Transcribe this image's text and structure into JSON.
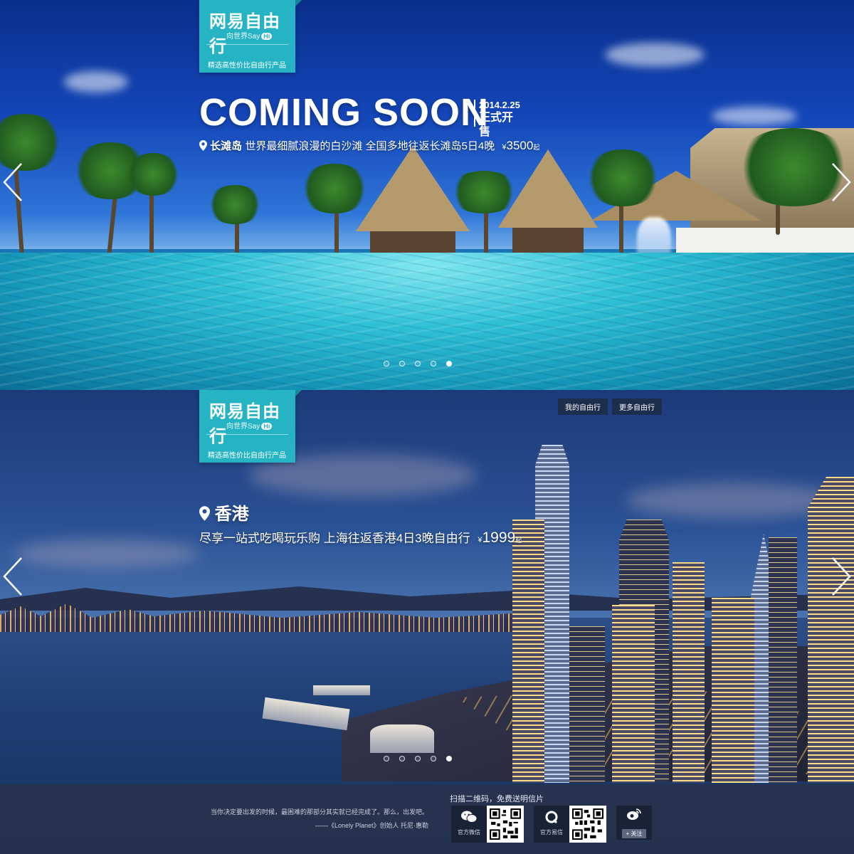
{
  "brand": {
    "logo_text": "网易自由行",
    "tagline": "向世界Say",
    "tagline_badge": "Hi",
    "slogan": "精选高性价比自由行产品"
  },
  "banner1": {
    "headline": "COMING SOON",
    "sale_date": "2014.2.25",
    "sale_label": "正式开售",
    "location": "长滩岛",
    "description": "世界最细腻浪漫的白沙滩  全国多地往返长滩岛5日4晚",
    "currency": "¥",
    "price": "3500",
    "price_suffix": "起",
    "carousel_dots": 5,
    "active_dot": 4
  },
  "banner2": {
    "nav": {
      "my_trip": "我的自由行",
      "more_trips": "更多自由行"
    },
    "location": "香港",
    "description": "尽享一站式吃喝玩乐购 上海往返香港4日3晚自由行",
    "currency": "¥",
    "price": "1999",
    "price_suffix": "起",
    "carousel_dots": 5,
    "active_dot": 4
  },
  "footer": {
    "quote_line1": "当你决定要出发的时候，最困难的那部分其实就已经完成了。那么，出发吧。",
    "quote_line2": "——《Lonely Planet》创始人 托尼·惠勒",
    "scan_title": "扫描二维码，免费送明信片",
    "wechat_label": "官方微信",
    "yixin_label": "官方易信",
    "follow_label": "+ 关注"
  },
  "icons": {
    "location": "location-pin-icon",
    "prev": "chevron-left-icon",
    "next": "chevron-right-icon",
    "wechat": "wechat-icon",
    "yixin": "yixin-icon",
    "weibo": "weibo-icon"
  },
  "colors": {
    "brand_teal": "#26b3c4",
    "footer_bg": "#28324b"
  }
}
